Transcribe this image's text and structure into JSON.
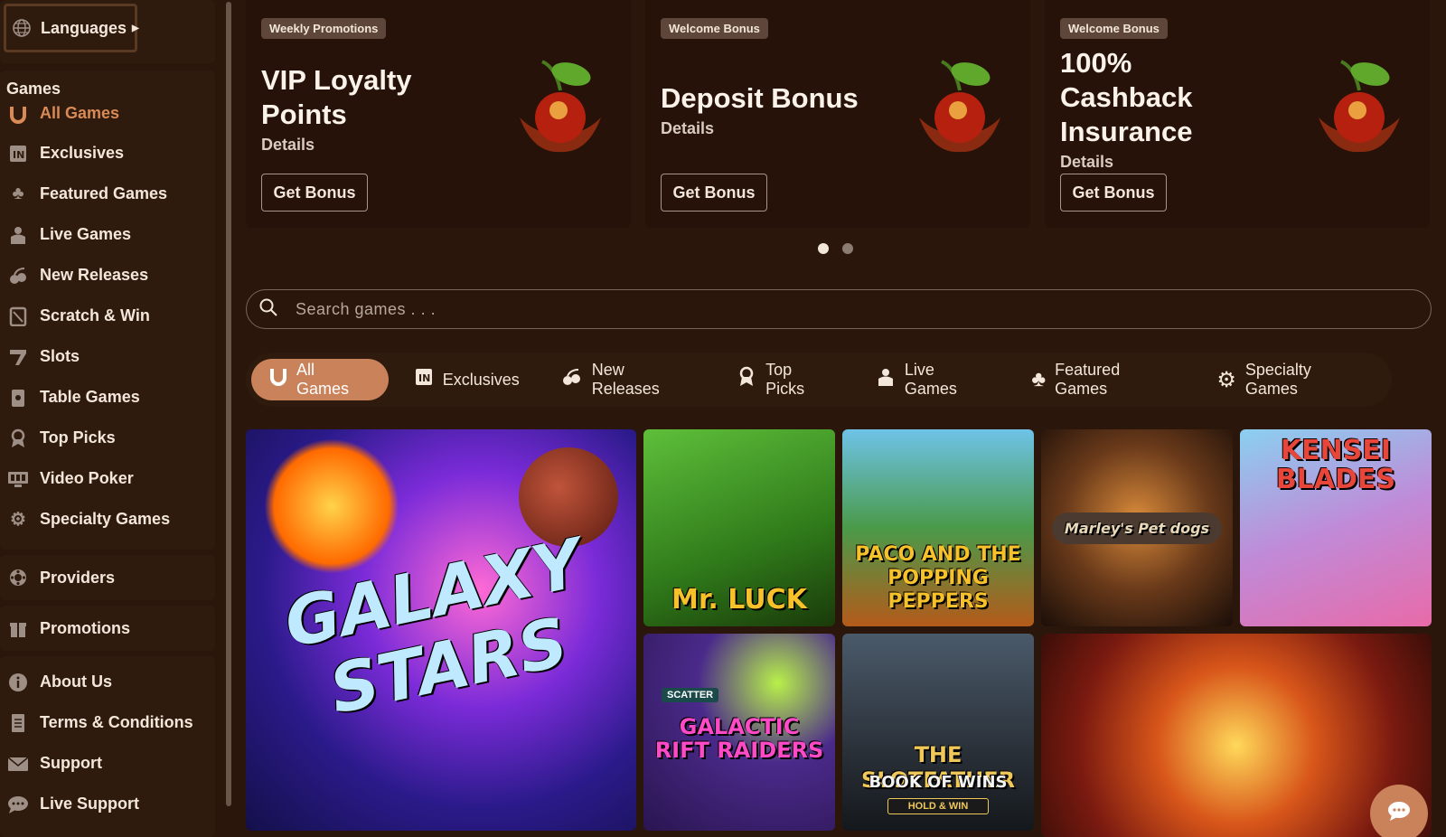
{
  "sidebar": {
    "languages_label": "Languages",
    "games_heading": "Games",
    "game_items": [
      {
        "label": "All Games",
        "icon": "horseshoe-icon"
      },
      {
        "label": "Exclusives",
        "icon": "exclusive-icon"
      },
      {
        "label": "Featured Games",
        "icon": "clover-icon"
      },
      {
        "label": "Live Games",
        "icon": "dealer-icon"
      },
      {
        "label": "New Releases",
        "icon": "cherry-icon"
      },
      {
        "label": "Scratch & Win",
        "icon": "scratch-icon"
      },
      {
        "label": "Slots",
        "icon": "slot-icon"
      },
      {
        "label": "Table Games",
        "icon": "cards-icon"
      },
      {
        "label": "Top Picks",
        "icon": "award-icon"
      },
      {
        "label": "Video Poker",
        "icon": "poker-icon"
      },
      {
        "label": "Specialty Games",
        "icon": "gear-icon"
      }
    ],
    "providers_label": "Providers",
    "promotions_label": "Promotions",
    "bottom_items": [
      {
        "label": "About Us",
        "icon": "info-icon"
      },
      {
        "label": "Terms & Conditions",
        "icon": "document-icon"
      },
      {
        "label": "Support",
        "icon": "mail-icon"
      },
      {
        "label": "Live Support",
        "icon": "chat-icon"
      }
    ]
  },
  "promos": [
    {
      "badge": "Weekly Promotions",
      "title": "VIP Loyalty Points",
      "details": "Details",
      "button": "Get Bonus"
    },
    {
      "badge": "Welcome Bonus",
      "title": "Deposit Bonus",
      "details": "Details",
      "button": "Get Bonus"
    },
    {
      "badge": "Welcome Bonus",
      "title": "100% Cashback Insurance",
      "details": "Details",
      "button": "Get Bonus"
    }
  ],
  "search": {
    "placeholder": "Search games . . ."
  },
  "tabs": [
    {
      "label": "All Games",
      "icon": "horseshoe-icon"
    },
    {
      "label": "Exclusives",
      "icon": "exclusive-icon"
    },
    {
      "label": "New Releases",
      "icon": "cherry-icon"
    },
    {
      "label": "Top Picks",
      "icon": "award-icon"
    },
    {
      "label": "Live Games",
      "icon": "dealer-icon"
    },
    {
      "label": "Featured Games",
      "icon": "clover-icon"
    },
    {
      "label": "Specialty Games",
      "icon": "gear-icon"
    }
  ],
  "games": [
    {
      "title": "GALAXY STARS"
    },
    {
      "title": "Mr. LUCK"
    },
    {
      "title": "PACO AND THE POPPING PEPPERS"
    },
    {
      "title": "Marley's Pet dogs"
    },
    {
      "title": "KENSEI BLADES"
    },
    {
      "title": "GALACTIC RIFT RAIDERS",
      "badge": "SCATTER"
    },
    {
      "title": "THE SLOTFATHER",
      "subtitle": "BOOK OF WINS",
      "badge": "HOLD & WIN"
    },
    {
      "title": ""
    }
  ],
  "colors": {
    "accent": "#c9825a",
    "background": "#2a160b"
  }
}
